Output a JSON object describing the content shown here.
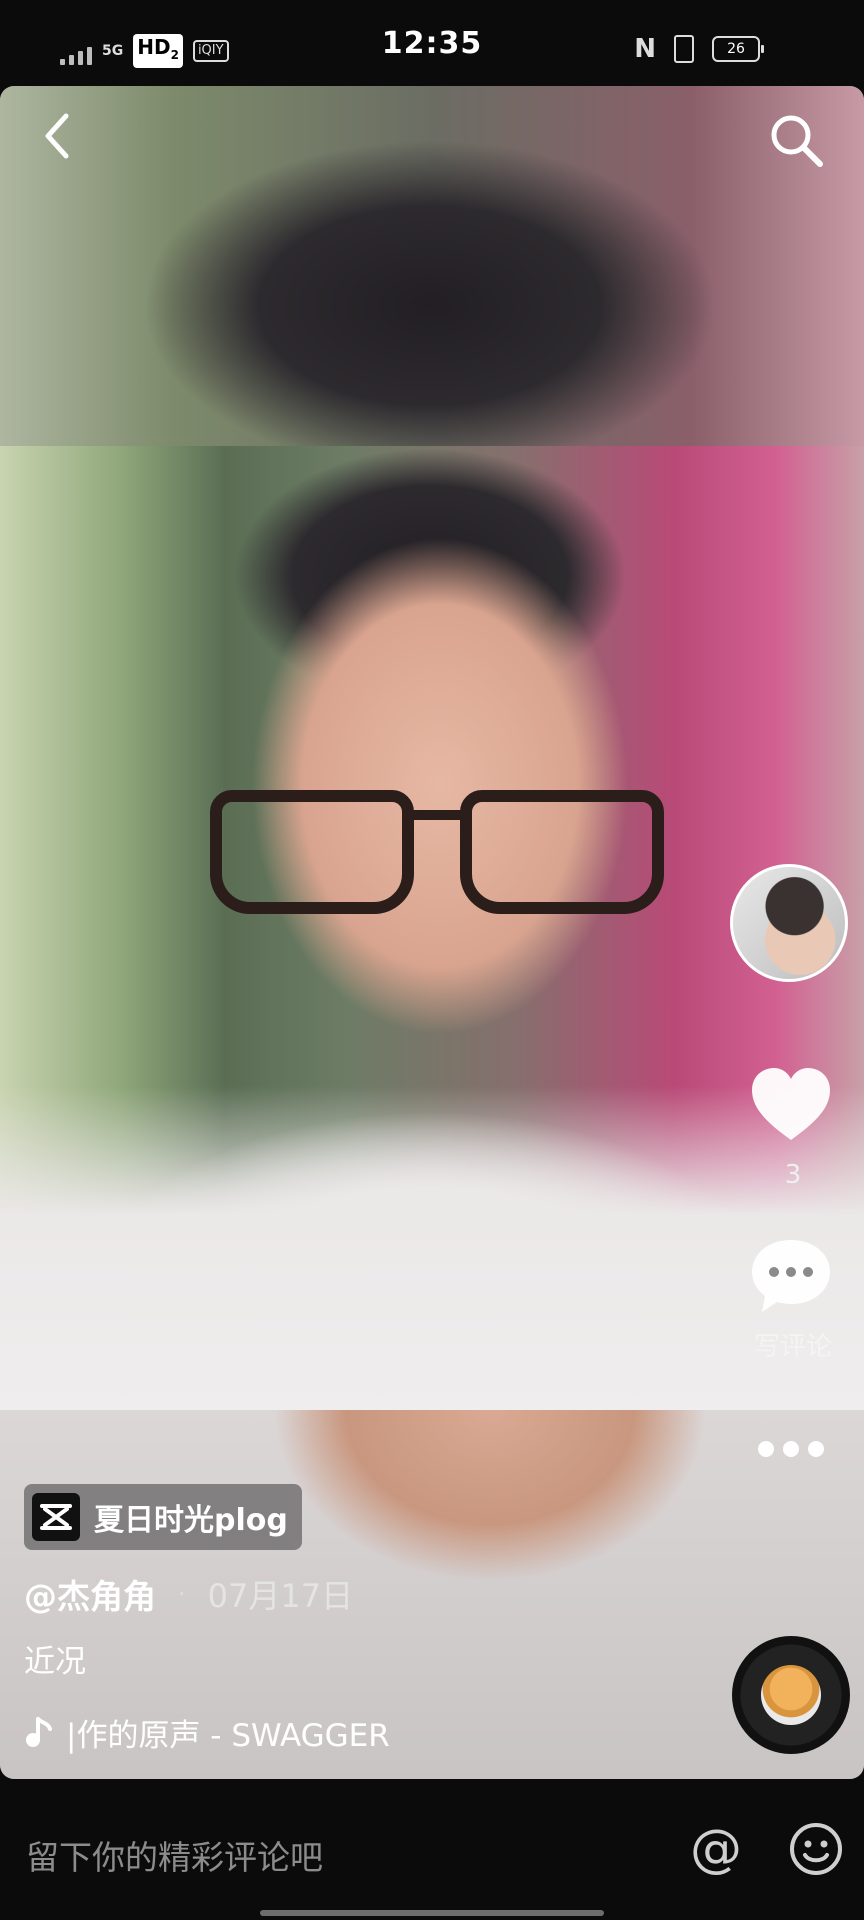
{
  "status_bar": {
    "network": "5G",
    "hd": "HD",
    "hd_sub": "2",
    "app_badge": "iQIY",
    "time": "12:35",
    "nfc": "N",
    "battery": "26"
  },
  "video": {
    "template_label": "夏日时光plog",
    "author": "@杰角角",
    "separator": "·",
    "date": "07月17日",
    "caption": "近况",
    "music": "|作的原声 - SWAGGER",
    "like_count": "3",
    "comment_label": "写评论"
  },
  "comment_bar": {
    "placeholder": "留下你的精彩评论吧",
    "at_symbol": "@"
  },
  "icons": {
    "back": "chevron-left-icon",
    "search": "search-icon",
    "like": "heart-icon",
    "comment": "comment-bubble-icon",
    "more": "more-dots-icon",
    "music": "music-note-icon",
    "emoji": "emoji-icon"
  }
}
